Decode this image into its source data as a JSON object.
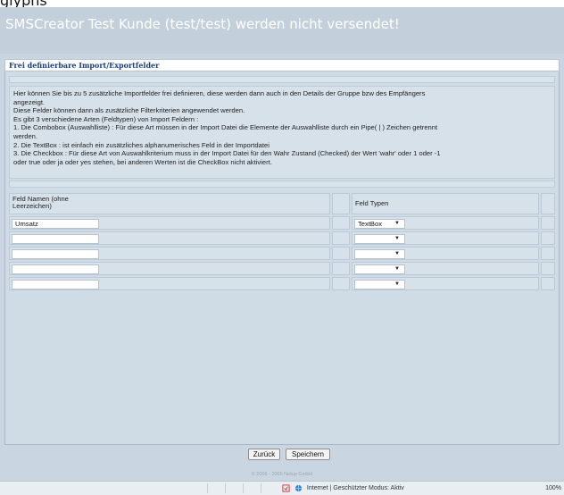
{
  "top_fragment": "glyphs",
  "banner": {
    "title": "SMSCreator  Test Kunde (test/test) werden nicht versendet!"
  },
  "section": {
    "title": "Frei definierbare Import/Exportfelder"
  },
  "info": {
    "lines": [
      "Hier können Sie bis zu 5 zusätzliche Importfelder frei definieren, diese werden dann auch in den Details der Gruppe bzw des Empfängers",
      "angezeigt.",
      "Diese Felder können dann als zusätzliche Filterkriterien angewendet werden.",
      "Es gibt 3 verschiedene Arten (Feldtypen) von Import Feldern :",
      "1. Die Combobox (Auswahlliste) : Für diese Art müssen in der Import Datei die Elemente der Auswahlliste durch ein Pipe( | ) Zeichen getrennt",
      "werden.",
      "2. Die TextBox : ist einfach ein zusätzliches alphanumerisches Feld in der Importdatei",
      "3. Die Checkbox : Für diese Art von Auswahlkriterium muss in der Import Datei für den Wahr Zustand (Checked) der Wert 'wahr' oder 1 oder -1",
      "oder true oder ja oder yes stehen, bei anderen Werten ist die CheckBox nicht aktiviert."
    ]
  },
  "table": {
    "col_name_header": "Feld Namen (ohne Leerzeichen)",
    "col_type_header": "Feld Typen",
    "rows": [
      {
        "name": "Umsatz",
        "type": "TextBox"
      },
      {
        "name": "",
        "type": ""
      },
      {
        "name": "",
        "type": ""
      },
      {
        "name": "",
        "type": ""
      },
      {
        "name": "",
        "type": ""
      }
    ]
  },
  "buttons": {
    "back": "Zurück",
    "save": "Speichern"
  },
  "footer": {
    "copyright": "© 2006 - 2009 Netup GmbH"
  },
  "statusbar": {
    "zone": "Internet | Geschützter Modus: Aktiv",
    "zoom": "100%"
  }
}
